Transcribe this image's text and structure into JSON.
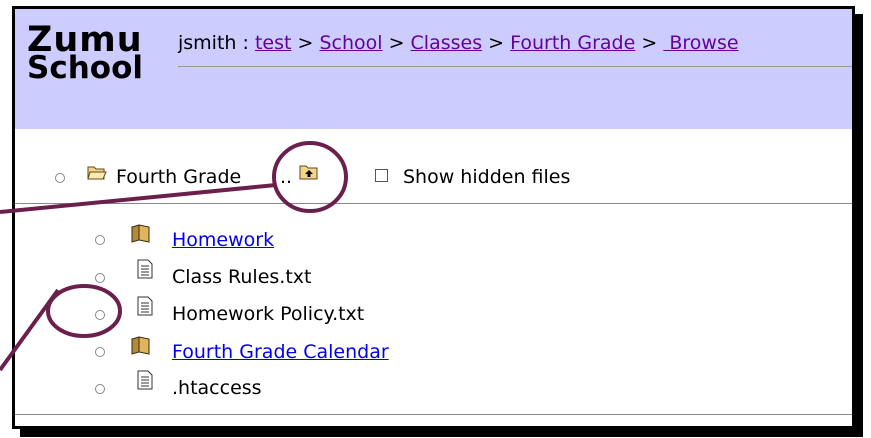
{
  "logo": {
    "line1": "Zumu",
    "line2": "School"
  },
  "breadcrumb": {
    "user": "jsmith",
    "separator": " : ",
    "arrow": " > ",
    "links": [
      "test",
      "School",
      "Classes",
      "Fourth Grade",
      " Browse"
    ]
  },
  "folder": {
    "name": "Fourth Grade",
    "up": "..",
    "show_hidden_label": "Show hidden files"
  },
  "files": [
    {
      "name": "Homework",
      "type": "folder",
      "link": true
    },
    {
      "name": "Class Rules.txt",
      "type": "file",
      "link": false
    },
    {
      "name": "Homework Policy.txt",
      "type": "file",
      "link": false
    },
    {
      "name": "Fourth Grade Calendar",
      "type": "folder",
      "link": true
    },
    {
      "name": ".htaccess",
      "type": "file",
      "link": false
    }
  ],
  "colors": {
    "header_bg": "#ccccff",
    "visited_link": "#660099",
    "link": "#1a1acc",
    "annotation": "#6b1f4d"
  }
}
